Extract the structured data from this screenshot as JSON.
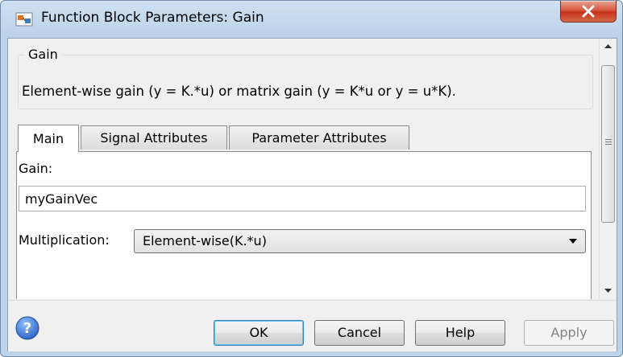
{
  "window": {
    "title": "Function Block Parameters: Gain",
    "icons": {
      "app": "simulink-block-icon",
      "close": "close-icon"
    }
  },
  "group": {
    "legend": "Gain",
    "description": "Element-wise gain (y = K.*u) or matrix gain (y = K*u or y = u*K)."
  },
  "tabs": [
    {
      "label": "Main",
      "active": true
    },
    {
      "label": "Signal Attributes",
      "active": false
    },
    {
      "label": "Parameter Attributes",
      "active": false
    }
  ],
  "main": {
    "gain_label": "Gain:",
    "gain_value": "myGainVec",
    "multiplication_label": "Multiplication:",
    "multiplication_value": "Element-wise(K.*u)"
  },
  "buttons": {
    "ok": "OK",
    "cancel": "Cancel",
    "help": "Help",
    "apply": "Apply",
    "apply_enabled": false
  },
  "colors": {
    "titlebar": "#bcd3ea",
    "close_button": "#c4321c",
    "default_button_border": "#3c7fb1",
    "help_icon": "#2f66c4"
  }
}
